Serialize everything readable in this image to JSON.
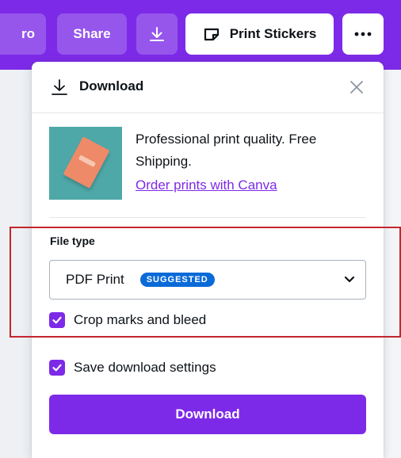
{
  "topbar": {
    "pro_label": "ro",
    "share_label": "Share",
    "download_icon": "download-icon",
    "print_label": "Print Stickers",
    "print_icon": "sticker-icon",
    "more_icon": "more-icon",
    "bg_color": "#7d2ae8"
  },
  "panel": {
    "title": "Download",
    "title_icon": "download-icon",
    "close_icon": "close-icon",
    "promo": {
      "text": "Professional print quality. Free Shipping.",
      "link": "Order prints with Canva"
    },
    "file_type": {
      "label": "File type",
      "selected": "PDF Print",
      "badge": "SUGGESTED"
    },
    "crop": {
      "label": "Crop marks and bleed",
      "checked": true
    },
    "save_settings": {
      "label": "Save download settings",
      "checked": true
    },
    "download_button": "Download"
  },
  "colors": {
    "accent": "#7d2ae8",
    "badge": "#0a6ad8",
    "highlight": "#c4262e"
  }
}
